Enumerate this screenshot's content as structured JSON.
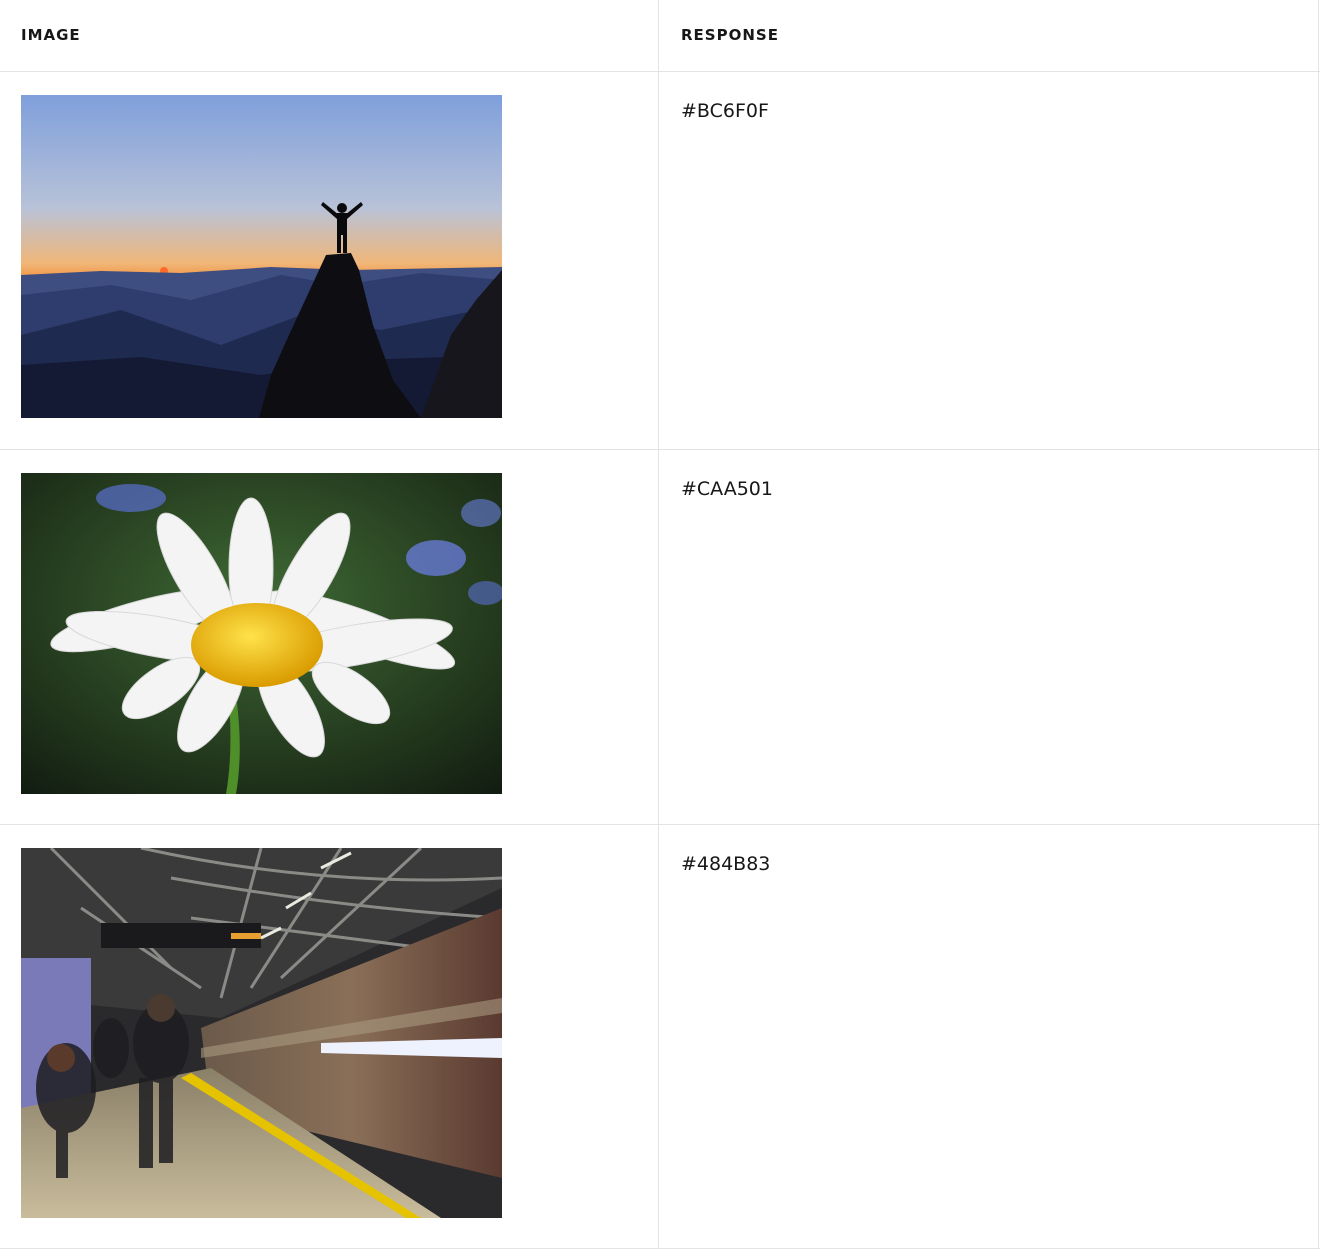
{
  "table": {
    "headers": {
      "image": "IMAGE",
      "response": "RESPONSE"
    },
    "rows": [
      {
        "image_subject": "silhouette of person with raised arms on mountain peak at sunset",
        "response": "#BC6F0F"
      },
      {
        "image_subject": "white daisy with yellow center and water droplets",
        "response": "#CAA501"
      },
      {
        "image_subject": "blurred subway train arriving at underground platform with commuters",
        "response": "#484B83"
      }
    ]
  }
}
